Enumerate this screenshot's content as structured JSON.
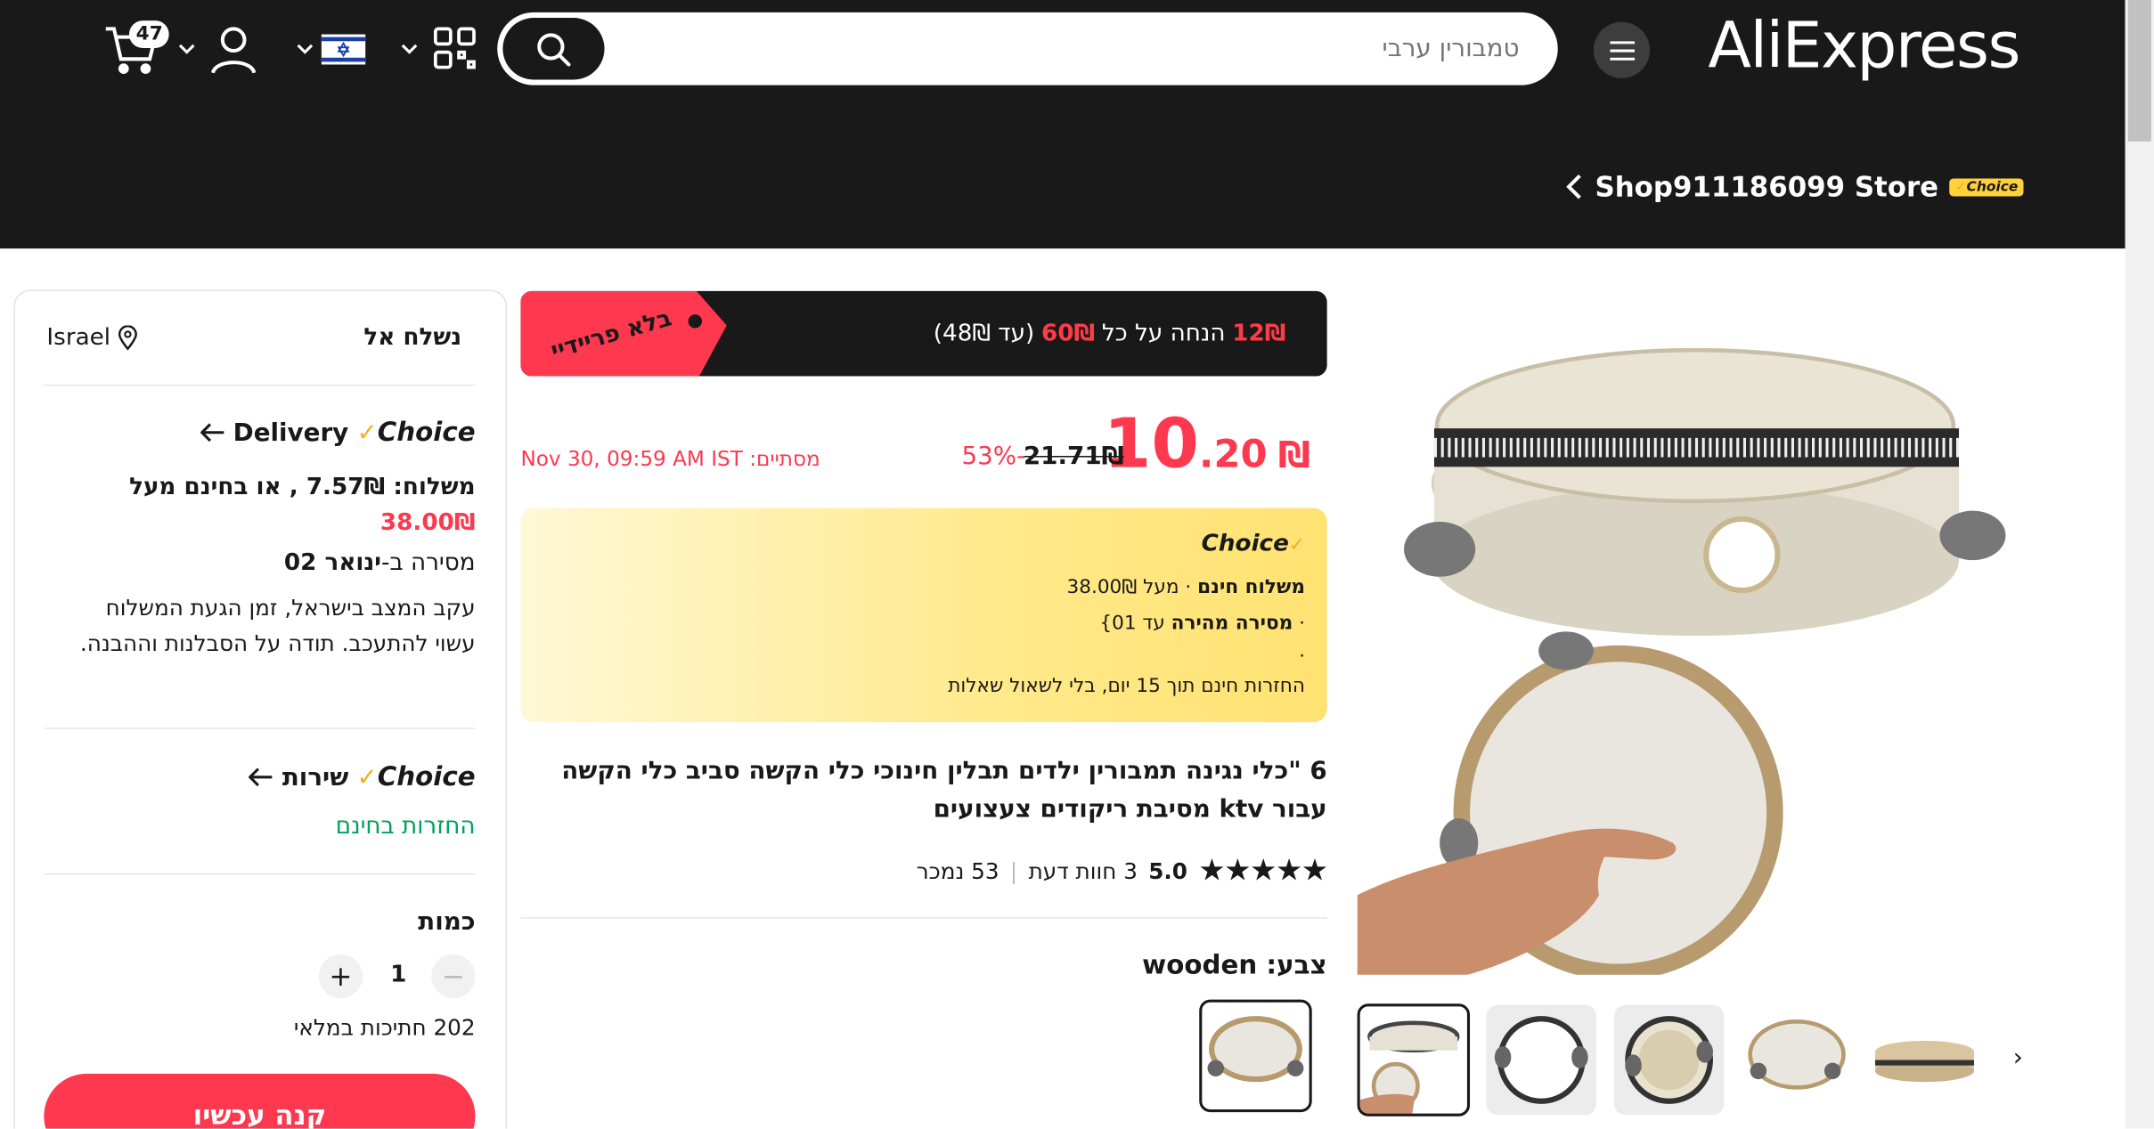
{
  "header": {
    "logo": "AliExpress",
    "search_placeholder": "טמבורין ערבי",
    "cart_count": "47",
    "store_name": "Shop911186099 Store",
    "store_badge": "Choice"
  },
  "promo": {
    "amount": "12₪",
    "text_mid": "הנחה על כל",
    "threshold": "60₪",
    "text_end": "(עד 48₪)",
    "tag": "בלא פריידיי"
  },
  "price": {
    "currency": "₪",
    "integer": "10",
    "decimal": ".20",
    "original": "21.71₪",
    "discount": "53%-",
    "sale_ends_label": "מסתיים:",
    "sale_ends_value": "Nov 30, 09:59 AM IST"
  },
  "choice_box": {
    "logo": "Choice",
    "line1_prefix": "· מעל 38.00₪",
    "line1_bold": "משלוח חינם",
    "line2_prefix": "·",
    "line2_bold": "מסירה מהירה",
    "line2_suffix": "עד 01}",
    "line3": "·",
    "line4": "החזרות חינם תוך 15 יום, בלי לשאול שאלות"
  },
  "product": {
    "title": "6 \"כלי נגינה תמבורין ילדים תבלין חינוכי כלי הקשה סביב כלי הקשה עבור ktv מסיבת ריקודים צעצועים",
    "rating": "5.0",
    "reviews_count": "3",
    "reviews_label": "חוות דעת",
    "sold_count": "53",
    "sold_label": "נמכר",
    "color_label": "צבע:",
    "color_value": "wooden"
  },
  "side": {
    "ship_to_label": "נשלח אל",
    "ship_to_value": "Israel",
    "delivery_label": "Delivery",
    "choice_logo": "Choice",
    "shipping_line": "משלוח: 7.57₪ , או בחינם מעל",
    "shipping_free_over": "38.00₪",
    "delivery_by_prefix": "מסירה ב-",
    "delivery_by_date": "ינואר 02",
    "delay_note": "עקב המצב בישראל, זמן הגעת המשלוח עשוי להתעכב. תודה על הסבלנות וההבנה.",
    "service_label": "שירות",
    "free_returns": "החזרות בחינם",
    "quantity_label": "כמות",
    "quantity_value": "1",
    "stock_note": "202 חתיכות במלאי",
    "buy_now": "קנה עכשיו"
  }
}
